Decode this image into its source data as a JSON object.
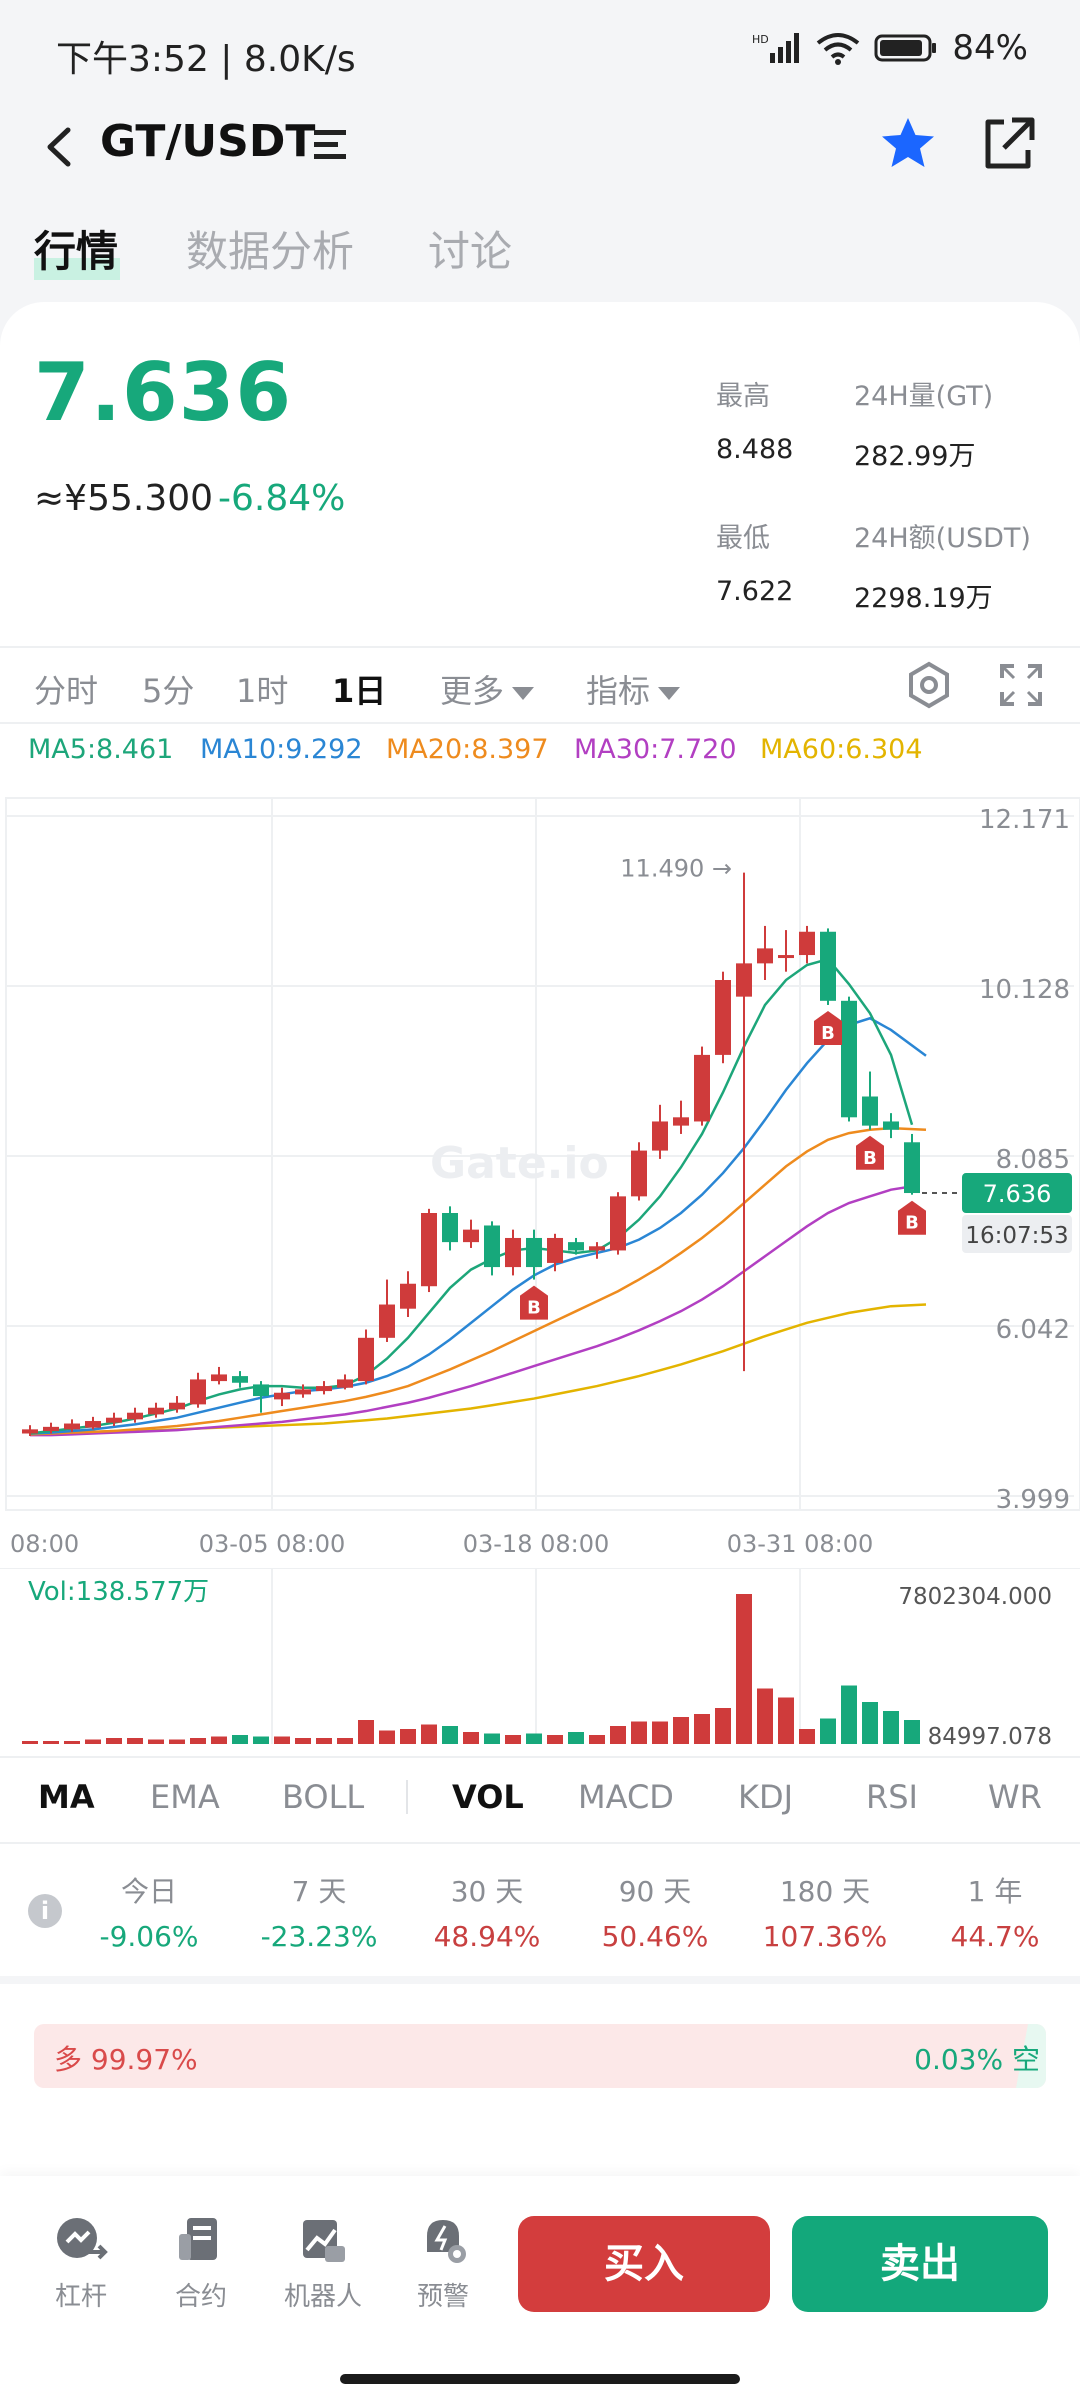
{
  "status": {
    "time": "下午3:52 | 8.0K/s",
    "battery": "84%"
  },
  "nav": {
    "pair": "GT/USDT",
    "star_color": "#1b66ff"
  },
  "tabs": [
    "行情",
    "数据分析",
    "讨论"
  ],
  "ticker": {
    "last": "7.636",
    "cny": "≈¥55.300",
    "change": "-6.84%",
    "high_label": "最高",
    "high": "8.488",
    "low_label": "最低",
    "low": "7.622",
    "vol_label": "24H量(GT)",
    "vol": "282.99万",
    "amt_label": "24H额(USDT)",
    "amt": "2298.19万"
  },
  "periods": [
    "分时",
    "5分",
    "1时",
    "1日",
    "更多",
    "指标"
  ],
  "ma_legend": [
    {
      "text": "MA5:8.461",
      "color": "#1da67a"
    },
    {
      "text": "MA10:9.292",
      "color": "#2a86d4"
    },
    {
      "text": "MA20:8.397",
      "color": "#ee8b1e"
    },
    {
      "text": "MA30:7.720",
      "color": "#b23fc2"
    },
    {
      "text": "MA60:6.304",
      "color": "#e3b400"
    }
  ],
  "chart_data": {
    "type": "candlestick",
    "title": "",
    "y_ticks": [
      "12.171",
      "10.128",
      "8.085",
      "6.042",
      "3.999"
    ],
    "ylim": [
      3.999,
      12.171
    ],
    "x_ticks": [
      "08:00",
      "03-05 08:00",
      "03-18 08:00",
      "03-31 08:00"
    ],
    "high_marker": "11.490 →",
    "last_price_tag": "7.636",
    "countdown": "16:07:53",
    "watermark": "Gate.io",
    "buy_marker_label": "B",
    "candles": [
      {
        "o": 4.75,
        "c": 4.8,
        "h": 4.85,
        "l": 4.72
      },
      {
        "o": 4.78,
        "c": 4.83,
        "h": 4.88,
        "l": 4.75
      },
      {
        "o": 4.8,
        "c": 4.87,
        "h": 4.92,
        "l": 4.77
      },
      {
        "o": 4.82,
        "c": 4.9,
        "h": 4.95,
        "l": 4.8
      },
      {
        "o": 4.88,
        "c": 4.94,
        "h": 5.0,
        "l": 4.84
      },
      {
        "o": 4.92,
        "c": 5.0,
        "h": 5.06,
        "l": 4.88
      },
      {
        "o": 4.98,
        "c": 5.06,
        "h": 5.12,
        "l": 4.94
      },
      {
        "o": 5.04,
        "c": 5.12,
        "h": 5.2,
        "l": 5.0
      },
      {
        "o": 5.1,
        "c": 5.4,
        "h": 5.48,
        "l": 5.06
      },
      {
        "o": 5.38,
        "c": 5.46,
        "h": 5.55,
        "l": 5.34
      },
      {
        "o": 5.44,
        "c": 5.36,
        "h": 5.5,
        "l": 5.3
      },
      {
        "o": 5.34,
        "c": 5.2,
        "h": 5.38,
        "l": 5.0
      },
      {
        "o": 5.16,
        "c": 5.24,
        "h": 5.3,
        "l": 5.08
      },
      {
        "o": 5.22,
        "c": 5.28,
        "h": 5.34,
        "l": 5.18
      },
      {
        "o": 5.26,
        "c": 5.32,
        "h": 5.38,
        "l": 5.22
      },
      {
        "o": 5.3,
        "c": 5.4,
        "h": 5.46,
        "l": 5.28
      },
      {
        "o": 5.38,
        "c": 5.9,
        "h": 6.0,
        "l": 5.34
      },
      {
        "o": 5.9,
        "c": 6.3,
        "h": 6.6,
        "l": 5.85
      },
      {
        "o": 6.25,
        "c": 6.55,
        "h": 6.7,
        "l": 6.15
      },
      {
        "o": 6.52,
        "c": 7.4,
        "h": 7.45,
        "l": 6.45
      },
      {
        "o": 7.4,
        "c": 7.05,
        "h": 7.48,
        "l": 6.95
      },
      {
        "o": 7.05,
        "c": 7.2,
        "h": 7.32,
        "l": 6.98
      },
      {
        "o": 7.25,
        "c": 6.75,
        "h": 7.3,
        "l": 6.65
      },
      {
        "o": 6.75,
        "c": 7.1,
        "h": 7.2,
        "l": 6.65
      },
      {
        "o": 7.1,
        "c": 6.75,
        "h": 7.2,
        "l": 6.6
      },
      {
        "o": 6.8,
        "c": 7.1,
        "h": 7.15,
        "l": 6.7
      },
      {
        "o": 7.05,
        "c": 6.95,
        "h": 7.1,
        "l": 6.9
      },
      {
        "o": 6.95,
        "c": 7.0,
        "h": 7.05,
        "l": 6.85
      },
      {
        "o": 6.95,
        "c": 7.6,
        "h": 7.65,
        "l": 6.9
      },
      {
        "o": 7.6,
        "c": 8.15,
        "h": 8.25,
        "l": 7.55
      },
      {
        "o": 8.15,
        "c": 8.5,
        "h": 8.7,
        "l": 8.05
      },
      {
        "o": 8.45,
        "c": 8.55,
        "h": 8.75,
        "l": 8.35
      },
      {
        "o": 8.5,
        "c": 9.3,
        "h": 9.4,
        "l": 8.45
      },
      {
        "o": 9.3,
        "c": 10.2,
        "h": 10.3,
        "l": 9.2
      },
      {
        "o": 10.0,
        "c": 10.4,
        "h": 11.49,
        "l": 5.5
      },
      {
        "o": 10.4,
        "c": 10.58,
        "h": 10.85,
        "l": 10.2
      },
      {
        "o": 10.5,
        "c": 10.5,
        "h": 10.8,
        "l": 10.3
      },
      {
        "o": 10.5,
        "c": 10.78,
        "h": 10.85,
        "l": 10.4
      },
      {
        "o": 10.78,
        "c": 9.95,
        "h": 10.82,
        "l": 9.9
      },
      {
        "o": 9.95,
        "c": 8.55,
        "h": 10.0,
        "l": 8.5
      },
      {
        "o": 8.8,
        "c": 8.45,
        "h": 9.1,
        "l": 8.4
      },
      {
        "o": 8.5,
        "c": 8.4,
        "h": 8.6,
        "l": 8.3
      },
      {
        "o": 8.25,
        "c": 7.64,
        "h": 8.35,
        "l": 7.62
      }
    ],
    "ma5": [
      4.75,
      4.78,
      4.81,
      4.84,
      4.88,
      4.93,
      4.99,
      5.05,
      5.14,
      5.22,
      5.28,
      5.32,
      5.32,
      5.3,
      5.3,
      5.33,
      5.45,
      5.65,
      5.9,
      6.2,
      6.5,
      6.72,
      6.85,
      6.95,
      6.98,
      6.95,
      6.92,
      6.95,
      7.1,
      7.32,
      7.6,
      7.95,
      8.35,
      8.85,
      9.4,
      9.9,
      10.2,
      10.38,
      10.45,
      10.15,
      9.8,
      9.3,
      8.46
    ],
    "ma10": [
      4.75,
      4.76,
      4.78,
      4.8,
      4.83,
      4.86,
      4.9,
      4.94,
      5.0,
      5.06,
      5.12,
      5.18,
      5.22,
      5.26,
      5.28,
      5.31,
      5.36,
      5.44,
      5.55,
      5.7,
      5.88,
      6.08,
      6.28,
      6.48,
      6.65,
      6.78,
      6.86,
      6.92,
      6.98,
      7.08,
      7.22,
      7.4,
      7.62,
      7.88,
      8.18,
      8.52,
      8.88,
      9.2,
      9.48,
      9.66,
      9.74,
      9.6,
      9.29
    ],
    "ma20": [
      4.74,
      4.75,
      4.76,
      4.77,
      4.78,
      4.8,
      4.82,
      4.84,
      4.87,
      4.9,
      4.94,
      4.98,
      5.02,
      5.06,
      5.1,
      5.14,
      5.19,
      5.25,
      5.32,
      5.42,
      5.52,
      5.63,
      5.74,
      5.86,
      5.98,
      6.1,
      6.22,
      6.34,
      6.46,
      6.6,
      6.75,
      6.92,
      7.1,
      7.3,
      7.52,
      7.74,
      7.96,
      8.14,
      8.28,
      8.36,
      8.4,
      8.42,
      8.4
    ],
    "ma30": [
      4.73,
      4.73,
      4.74,
      4.75,
      4.76,
      4.77,
      4.78,
      4.79,
      4.81,
      4.83,
      4.85,
      4.87,
      4.89,
      4.92,
      4.95,
      4.98,
      5.02,
      5.07,
      5.12,
      5.18,
      5.25,
      5.32,
      5.4,
      5.48,
      5.56,
      5.64,
      5.72,
      5.8,
      5.89,
      5.99,
      6.1,
      6.22,
      6.36,
      6.52,
      6.7,
      6.88,
      7.06,
      7.24,
      7.4,
      7.52,
      7.6,
      7.68,
      7.72
    ],
    "ma60": [
      4.76,
      4.76,
      4.77,
      4.77,
      4.78,
      4.78,
      4.79,
      4.8,
      4.81,
      4.82,
      4.83,
      4.84,
      4.85,
      4.86,
      4.87,
      4.89,
      4.91,
      4.93,
      4.96,
      4.99,
      5.02,
      5.05,
      5.09,
      5.13,
      5.17,
      5.22,
      5.27,
      5.32,
      5.38,
      5.44,
      5.51,
      5.58,
      5.66,
      5.74,
      5.83,
      5.92,
      6.0,
      6.08,
      6.14,
      6.2,
      6.24,
      6.28,
      6.3
    ],
    "buy_markers": [
      24,
      38,
      40,
      42
    ],
    "volume": {
      "label": "Vol:138.577万",
      "max_label": "7802304.000",
      "min_label": "84997.078",
      "values": [
        0.02,
        0.02,
        0.02,
        0.03,
        0.04,
        0.04,
        0.03,
        0.03,
        0.04,
        0.05,
        0.06,
        0.05,
        0.05,
        0.04,
        0.04,
        0.04,
        0.16,
        0.09,
        0.1,
        0.13,
        0.12,
        0.08,
        0.07,
        0.06,
        0.07,
        0.06,
        0.08,
        0.06,
        0.12,
        0.15,
        0.15,
        0.18,
        0.2,
        0.24,
        1.0,
        0.37,
        0.31,
        0.1,
        0.17,
        0.39,
        0.28,
        0.22,
        0.16
      ]
    }
  },
  "indicators": [
    "MA",
    "EMA",
    "BOLL",
    "VOL",
    "MACD",
    "KDJ",
    "RSI",
    "WR"
  ],
  "performance": [
    {
      "label": "今日",
      "value": "-9.06%",
      "color": "#17a87b"
    },
    {
      "label": "7 天",
      "value": "-23.23%",
      "color": "#17a87b"
    },
    {
      "label": "30 天",
      "value": "48.94%",
      "color": "#c84040"
    },
    {
      "label": "90 天",
      "value": "50.46%",
      "color": "#c84040"
    },
    {
      "label": "180 天",
      "value": "107.36%",
      "color": "#c84040"
    },
    {
      "label": "1 年",
      "value": "44.7%",
      "color": "#c84040"
    }
  ],
  "long_short": {
    "long": "多 99.97%",
    "short": "0.03% 空"
  },
  "bottom": {
    "items": [
      "杠杆",
      "合约",
      "机器人",
      "预警"
    ],
    "buy": "买入",
    "sell": "卖出"
  }
}
